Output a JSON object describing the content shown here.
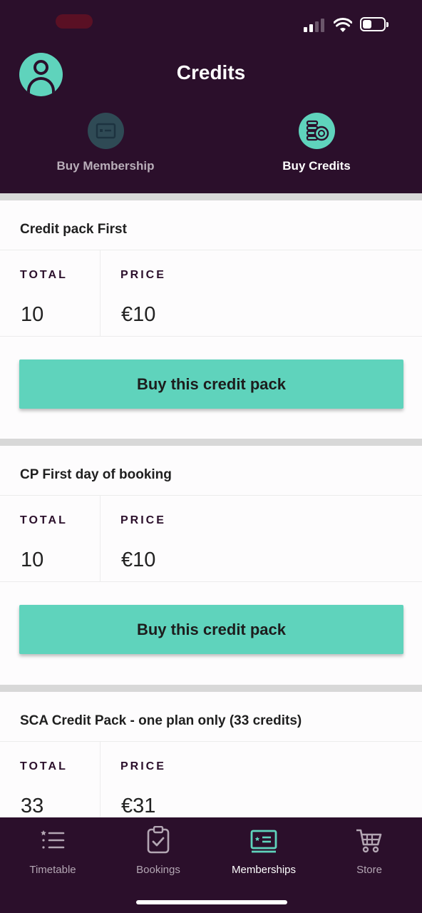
{
  "header": {
    "title": "Credits",
    "profile_icon": "user-avatar-icon"
  },
  "tabs": [
    {
      "label": "Buy Membership",
      "icon": "membership-card-icon",
      "active": false
    },
    {
      "label": "Buy Credits",
      "icon": "credits-coins-icon",
      "active": true
    }
  ],
  "packs": [
    {
      "title": "Credit pack First",
      "total_label": "TOTAL",
      "total": "10",
      "price_label": "PRICE",
      "price": "€10",
      "button": "Buy this credit pack"
    },
    {
      "title": "CP First day of booking",
      "total_label": "TOTAL",
      "total": "10",
      "price_label": "PRICE",
      "price": "€10",
      "button": "Buy this credit pack"
    },
    {
      "title": "SCA Credit Pack - one plan only (33 credits)",
      "total_label": "TOTAL",
      "total": "33",
      "price_label": "PRICE",
      "price": "€31"
    }
  ],
  "bottom_nav": [
    {
      "label": "Timetable",
      "icon": "list-icon",
      "active": false
    },
    {
      "label": "Bookings",
      "icon": "clipboard-check-icon",
      "active": false
    },
    {
      "label": "Memberships",
      "icon": "membership-card-icon",
      "active": true
    },
    {
      "label": "Store",
      "icon": "cart-icon",
      "active": false
    }
  ],
  "colors": {
    "header_bg": "#2b0f2b",
    "accent": "#5fd3bc"
  }
}
